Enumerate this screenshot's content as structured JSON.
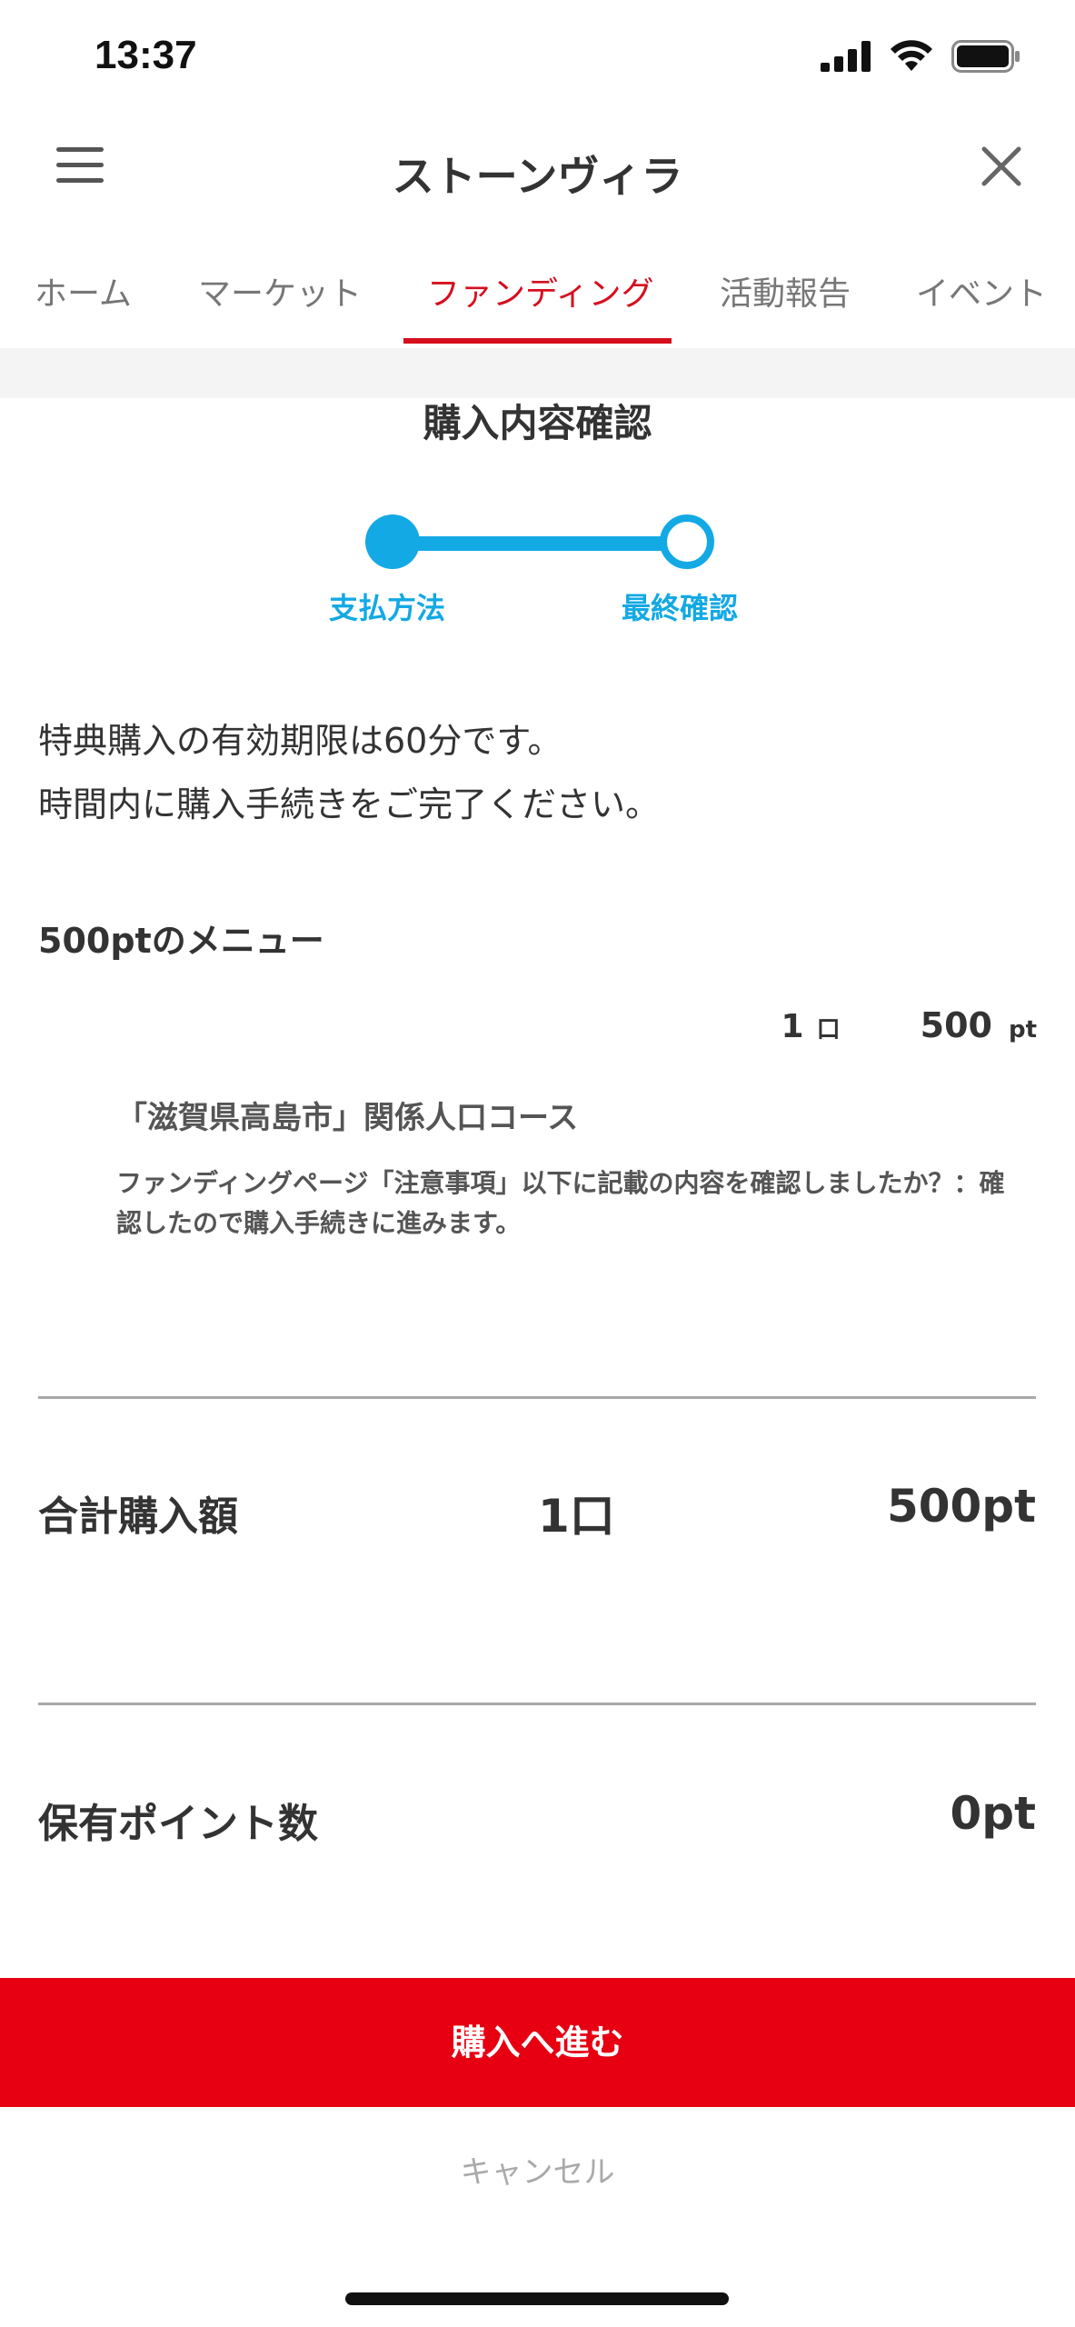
{
  "status_bar": {
    "time": "13:37"
  },
  "header": {
    "title": "ストーンヴィラ"
  },
  "tabs": [
    {
      "label": "ホーム",
      "active": false
    },
    {
      "label": "マーケット",
      "active": false
    },
    {
      "label": "ファンディング",
      "active": true
    },
    {
      "label": "活動報告",
      "active": false
    },
    {
      "label": "イベント",
      "active": false
    }
  ],
  "page": {
    "section_title": "購入内容確認",
    "steps": [
      {
        "label": "支払方法",
        "state": "completed"
      },
      {
        "label": "最終確認",
        "state": "current"
      }
    ],
    "notice_line1": "特典購入の有効期限は60分です。",
    "notice_line2": "時間内に購入手続きをご完了ください。",
    "menu_heading": "500ptのメニュー",
    "item": {
      "quantity": "1",
      "quantity_unit": "口",
      "points": "500",
      "points_unit": "pt",
      "course_name": "「滋賀県高島市」関係人口コース",
      "description": "ファンディングページ「注意事項」以下に記載の内容を確認しましたか？：確認したので購入手続きに進みます。"
    },
    "total": {
      "label": "合計購入額",
      "quantity": "1口",
      "amount": "500pt"
    },
    "owned": {
      "label": "保有ポイント数",
      "amount": "0pt"
    }
  },
  "actions": {
    "proceed_label": "購入へ進む",
    "cancel_label": "キャンセル"
  },
  "colors": {
    "accent_red": "#e60012",
    "tab_active": "#d60f1f",
    "stepper_blue": "#13a9e4"
  }
}
